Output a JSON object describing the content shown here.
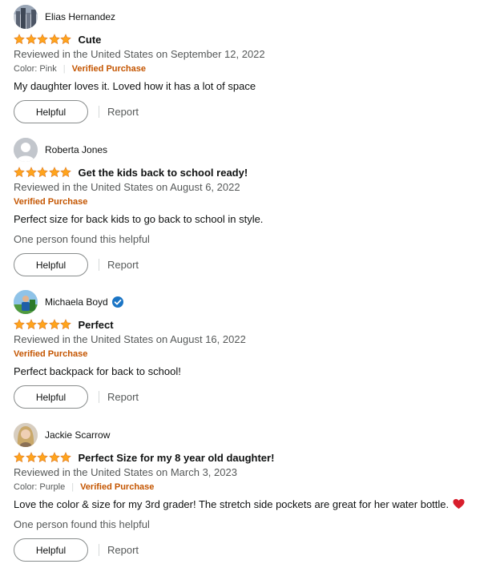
{
  "colors": {
    "star": "#ffa41c",
    "verified_purchase": "#c45500",
    "muted": "#565959",
    "badge": "#1b75c5"
  },
  "reviews": [
    {
      "author": "Elias Hernandez",
      "stars": 5,
      "title": "Cute",
      "date": "Reviewed in the United States on September 12, 2022",
      "color_label": "Color: Pink",
      "verified": "Verified Purchase",
      "body": "My daughter loves it. Loved how it has a lot of space",
      "helpful_count_text": "",
      "helpful_label": "Helpful",
      "report_label": "Report"
    },
    {
      "author": "Roberta Jones",
      "stars": 5,
      "title": "Get the kids back to school ready!",
      "date": "Reviewed in the United States on August 6, 2022",
      "color_label": "",
      "verified": "Verified Purchase",
      "body": "Perfect size for back kids to go back to school in style.",
      "helpful_count_text": "One person found this helpful",
      "helpful_label": "Helpful",
      "report_label": "Report"
    },
    {
      "author": "Michaela Boyd",
      "stars": 5,
      "title": "Perfect",
      "date": "Reviewed in the United States on August 16, 2022",
      "color_label": "",
      "verified": "Verified Purchase",
      "body": "Perfect backpack for back to school!",
      "helpful_count_text": "",
      "helpful_label": "Helpful",
      "report_label": "Report"
    },
    {
      "author": "Jackie Scarrow",
      "stars": 5,
      "title": "Perfect Size for my 8 year old daughter!",
      "date": "Reviewed in the United States on March 3, 2023",
      "color_label": "Color: Purple",
      "verified": "Verified Purchase",
      "body": "Love the color & size for my 3rd grader! The stretch side pockets are great for her water bottle.",
      "helpful_count_text": "One person found this helpful",
      "helpful_label": "Helpful",
      "report_label": "Report"
    }
  ]
}
